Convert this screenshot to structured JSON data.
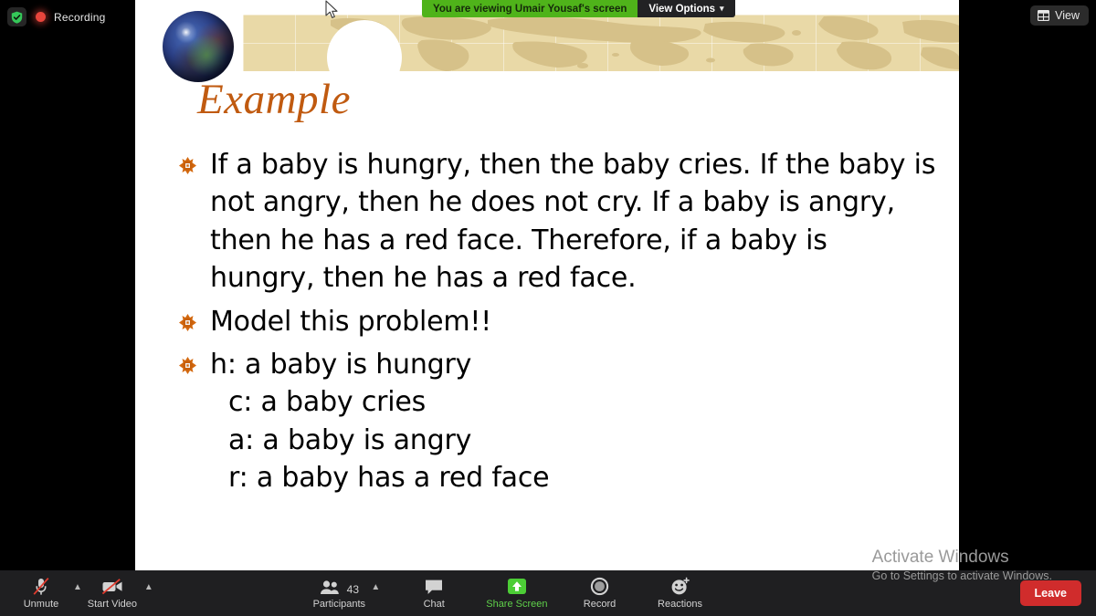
{
  "recording": {
    "shield_icon": "shield-check-icon",
    "dot_icon": "recording-dot-icon",
    "label": "Recording"
  },
  "view_button": {
    "icon": "grid-layout-icon",
    "label": "View"
  },
  "share_banner": {
    "message": "You are viewing Umair Yousaf's screen",
    "view_options_label": "View Options",
    "caret_icon": "chevron-down-icon",
    "green_color": "#4fb31a",
    "dark_color": "#222224"
  },
  "slide": {
    "title": "Example",
    "title_color": "#c05a10",
    "banner_color": "#e9d9a7",
    "bullet_icon": "orange-target-bullet-icon",
    "bullets": [
      "If a baby is hungry, then the baby cries. If the baby is not angry, then he does not cry. If a baby is angry, then he has a red face. Therefore, if a baby is hungry, then he has a red face.",
      "Model this problem!!",
      "h: a baby is hungry"
    ],
    "sub_lines": [
      "c: a baby cries",
      "a: a baby is angry",
      "r: a baby has a red face"
    ]
  },
  "watermark": {
    "line1": "Activate Windows",
    "line2": "Go to Settings to activate Windows."
  },
  "toolbar": {
    "mute": {
      "icon": "microphone-muted-icon",
      "label": "Unmute",
      "caret_icon": "chevron-up-icon"
    },
    "video": {
      "icon": "video-camera-off-icon",
      "label": "Start Video",
      "caret_icon": "chevron-up-icon"
    },
    "participants": {
      "icon": "participants-icon",
      "label": "Participants",
      "count": "43",
      "caret_icon": "chevron-up-icon"
    },
    "chat": {
      "icon": "chat-bubble-icon",
      "label": "Chat"
    },
    "share_screen": {
      "icon": "share-screen-up-arrow-icon",
      "label": "Share Screen",
      "color": "#5fd04a"
    },
    "record": {
      "icon": "record-circle-icon",
      "label": "Record"
    },
    "reactions": {
      "icon": "reactions-smiley-icon",
      "label": "Reactions"
    },
    "leave": {
      "label": "Leave",
      "color": "#d02c2c"
    }
  },
  "cursor": {
    "icon": "arrow-pointer-cursor"
  }
}
